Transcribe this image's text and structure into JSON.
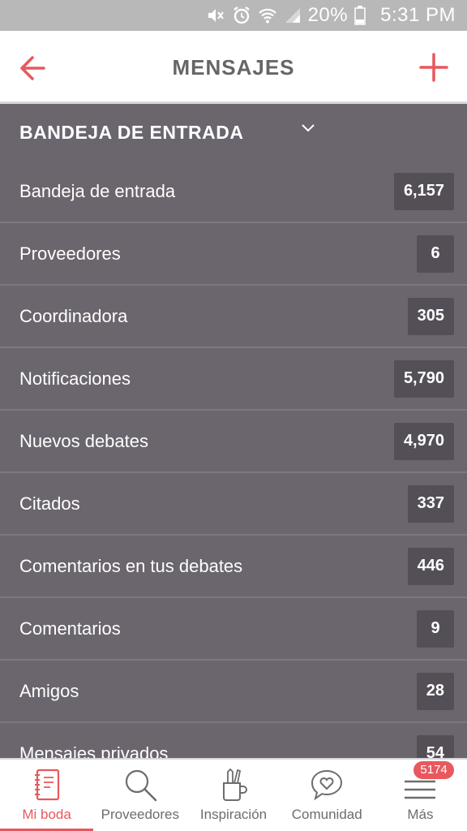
{
  "status_bar": {
    "battery_percent": "20%",
    "time": "5:31 PM",
    "icons": [
      "mute-icon",
      "alarm-icon",
      "wifi-icon",
      "signal-icon",
      "battery-icon"
    ]
  },
  "header": {
    "title": "MENSAJES",
    "back_icon": "arrow-left-icon",
    "add_icon": "plus-icon",
    "accent_color": "#e8585e"
  },
  "section": {
    "title": "BANDEJA DE ENTRADA",
    "icon": "chevron-down-icon"
  },
  "rows": [
    {
      "label": "Bandeja de entrada",
      "count": "6,157"
    },
    {
      "label": "Proveedores",
      "count": "6"
    },
    {
      "label": "Coordinadora",
      "count": "305"
    },
    {
      "label": "Notificaciones",
      "count": "5,790"
    },
    {
      "label": "Nuevos debates",
      "count": "4,970"
    },
    {
      "label": "Citados",
      "count": "337"
    },
    {
      "label": "Comentarios en tus debates",
      "count": "446"
    },
    {
      "label": "Comentarios",
      "count": "9"
    },
    {
      "label": "Amigos",
      "count": "28"
    },
    {
      "label": "Mensajes privados",
      "count": "54"
    }
  ],
  "bottom_nav": {
    "items": [
      {
        "label": "Mi boda",
        "icon": "notebook-icon",
        "active": true
      },
      {
        "label": "Proveedores",
        "icon": "search-icon",
        "active": false
      },
      {
        "label": "Inspiración",
        "icon": "pencil-cup-icon",
        "active": false
      },
      {
        "label": "Comunidad",
        "icon": "heart-chat-icon",
        "active": false
      },
      {
        "label": "Más",
        "icon": "menu-icon",
        "active": false,
        "badge": "5174"
      }
    ]
  }
}
